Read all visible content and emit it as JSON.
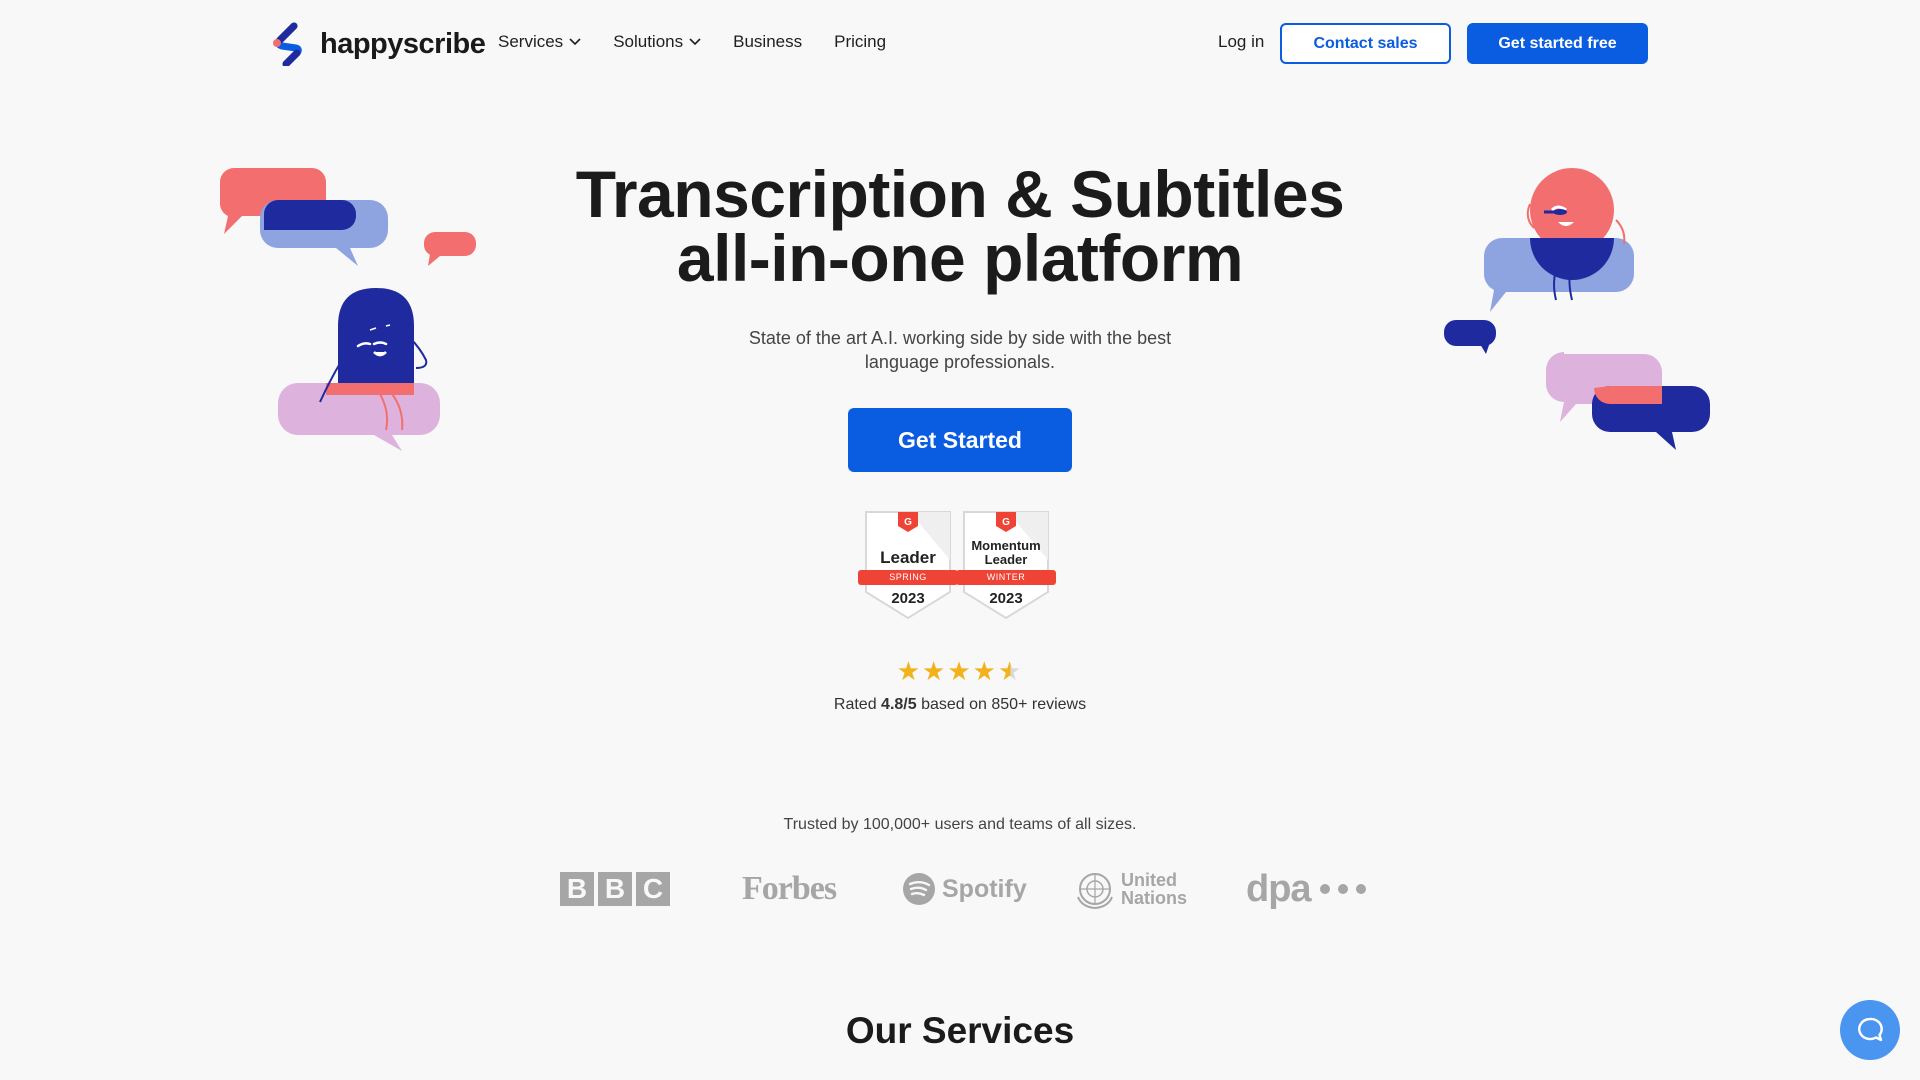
{
  "brand": {
    "name": "happyscribe"
  },
  "nav": {
    "items": [
      {
        "label": "Services",
        "dropdown": true
      },
      {
        "label": "Solutions",
        "dropdown": true
      },
      {
        "label": "Business",
        "dropdown": false
      },
      {
        "label": "Pricing",
        "dropdown": false
      }
    ],
    "login": "Log in",
    "contact_sales": "Contact sales",
    "get_started_free": "Get started free"
  },
  "hero": {
    "title_line1": "Transcription & Subtitles",
    "title_line2": "all-in-one platform",
    "subtitle": "State of the art A.I. working side by side with the best language professionals.",
    "cta": "Get Started"
  },
  "badges": [
    {
      "title": "Leader",
      "season": "SPRING",
      "year": "2023"
    },
    {
      "title": "Momentum Leader",
      "season": "WINTER",
      "year": "2023"
    }
  ],
  "rating": {
    "stars": 4.5,
    "prefix": "Rated",
    "score": "4.8/5",
    "suffix": "based on 850+ reviews"
  },
  "trusted": {
    "text": "Trusted by 100,000+ users and teams of all sizes.",
    "logos": [
      "BBC",
      "Forbes",
      "Spotify",
      "United Nations",
      "dpa"
    ]
  },
  "services": {
    "title": "Our Services"
  },
  "colors": {
    "primary": "#0a5ce0",
    "coral": "#f36f6f",
    "navy": "#1f2a9e",
    "periwinkle": "#8ea4e0",
    "lilac": "#ddb2dd",
    "star": "#f1b21b",
    "badge_red": "#ef4335"
  },
  "icons": {
    "chat": "chat-icon",
    "chevron": "chevron-down-icon"
  }
}
